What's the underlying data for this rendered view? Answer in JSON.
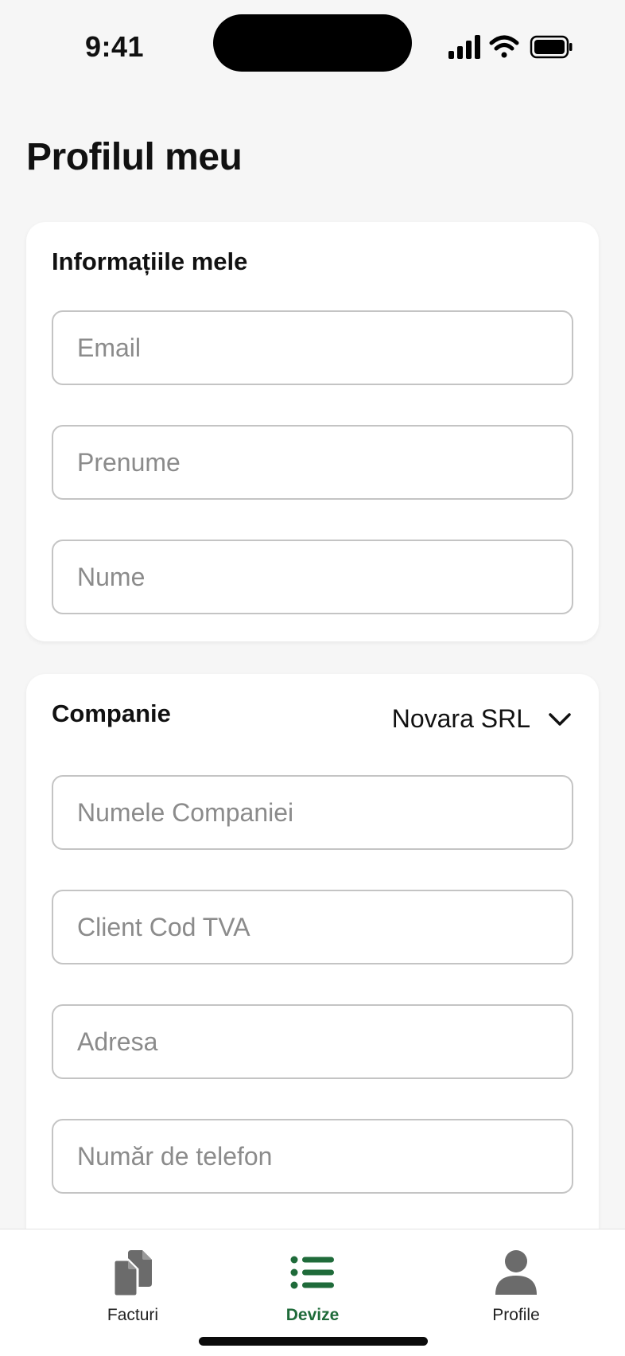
{
  "status_bar": {
    "time": "9:41"
  },
  "page": {
    "title": "Profilul meu"
  },
  "info_card": {
    "title": "Informațiile mele",
    "fields": [
      {
        "placeholder": "Email",
        "value": ""
      },
      {
        "placeholder": "Prenume",
        "value": ""
      },
      {
        "placeholder": "Nume",
        "value": ""
      }
    ]
  },
  "company_card": {
    "title": "Companie",
    "selected_company": "Novara SRL",
    "fields": [
      {
        "placeholder": "Numele Companiei",
        "value": ""
      },
      {
        "placeholder": "Client Cod TVA",
        "value": ""
      },
      {
        "placeholder": "Adresa",
        "value": ""
      },
      {
        "placeholder": "Număr de telefon",
        "value": ""
      }
    ]
  },
  "tab_bar": {
    "tabs": [
      {
        "label": "Facturi",
        "icon": "documents-icon",
        "active": false
      },
      {
        "label": "Devize",
        "icon": "list-icon",
        "active": true
      },
      {
        "label": "Profile",
        "icon": "person-icon",
        "active": false
      }
    ]
  },
  "colors": {
    "accent": "#1f6b3a",
    "background": "#f6f6f6",
    "card": "#ffffff",
    "border": "#c4c4c4",
    "placeholder": "#8b8b8b",
    "inactive_icon": "#6b6b6b"
  }
}
